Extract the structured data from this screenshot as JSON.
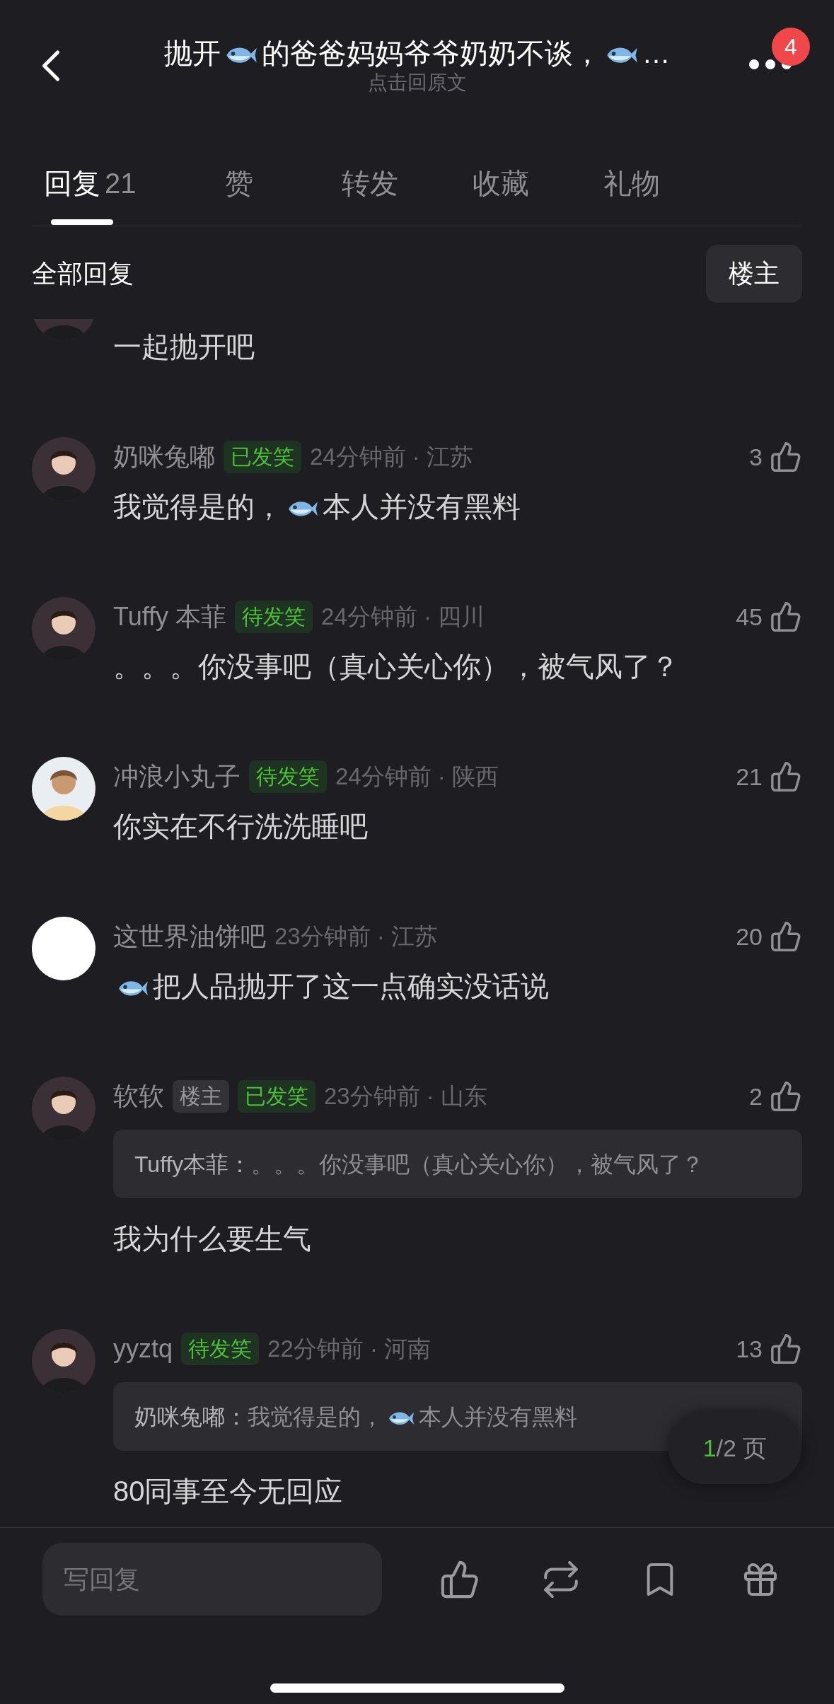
{
  "header": {
    "title": [
      {
        "kind": "text",
        "text": "抛开"
      },
      {
        "kind": "fish"
      },
      {
        "kind": "text",
        "text": "的爸爸妈妈爷爷奶奶不谈，"
      },
      {
        "kind": "fish"
      },
      {
        "kind": "text",
        "text": "…"
      }
    ],
    "subtitle": "点击回原文",
    "badge": "4"
  },
  "tabs": [
    {
      "label": "回复",
      "count": "21",
      "selected": true
    },
    {
      "label": "赞",
      "selected": false
    },
    {
      "label": "转发",
      "selected": false
    },
    {
      "label": "收藏",
      "selected": false
    },
    {
      "label": "礼物",
      "selected": false
    }
  ],
  "section": {
    "title": "全部回复",
    "filter_button": "楼主"
  },
  "comments": [
    {
      "partial": true,
      "body": [
        {
          "kind": "text",
          "text": "一起抛开吧"
        }
      ]
    },
    {
      "name": "奶咪兔嘟",
      "tags": [
        {
          "kind": "status",
          "label": "已发笑"
        }
      ],
      "meta": "24分钟前 · 江苏",
      "likes": "3",
      "body": [
        {
          "kind": "text",
          "text": "我觉得是的，"
        },
        {
          "kind": "fish"
        },
        {
          "kind": "text",
          "text": "本人并没有黑料"
        }
      ]
    },
    {
      "name": "Tuffy 本菲",
      "tags": [
        {
          "kind": "status",
          "label": "待发笑"
        }
      ],
      "meta": "24分钟前 · 四川",
      "likes": "45",
      "body": [
        {
          "kind": "text",
          "text": "。。。你没事吧（真心关心你），被气风了？"
        }
      ]
    },
    {
      "name": "冲浪小丸子",
      "tags": [
        {
          "kind": "status",
          "label": "待发笑"
        }
      ],
      "meta": "24分钟前 · 陕西",
      "likes": "21",
      "body": [
        {
          "kind": "text",
          "text": "你实在不行洗洗睡吧"
        }
      ]
    },
    {
      "name": "这世界油饼吧",
      "meta": "23分钟前 · 江苏",
      "likes": "20",
      "blank_avatar": true,
      "body": [
        {
          "kind": "fish"
        },
        {
          "kind": "text",
          "text": "把人品抛开了这一点确实没话说"
        }
      ]
    },
    {
      "name": "软软",
      "tags": [
        {
          "kind": "op",
          "label": "楼主"
        },
        {
          "kind": "status",
          "label": "已发笑"
        }
      ],
      "meta": "23分钟前 · 山东",
      "likes": "2",
      "quote": {
        "author": "Tuffy本菲：",
        "text": [
          {
            "kind": "text",
            "text": "。。。你没事吧（真心关心你），被气风了？"
          }
        ]
      },
      "body": [
        {
          "kind": "text",
          "text": "我为什么要生气"
        }
      ]
    },
    {
      "name": "yyztq",
      "tags": [
        {
          "kind": "status",
          "label": "待发笑"
        }
      ],
      "meta": "22分钟前 · 河南",
      "likes": "13",
      "quote": {
        "author": "奶咪兔嘟：",
        "text": [
          {
            "kind": "text",
            "text": "我觉得是的，"
          },
          {
            "kind": "fish"
          },
          {
            "kind": "text",
            "text": "本人并没有黑料"
          }
        ]
      },
      "body": [
        {
          "kind": "text",
          "text": "80同事至今无回应"
        }
      ]
    }
  ],
  "pager": {
    "current": "1",
    "rest": "/2 页"
  },
  "reply_field": {
    "placeholder": "写回复"
  }
}
